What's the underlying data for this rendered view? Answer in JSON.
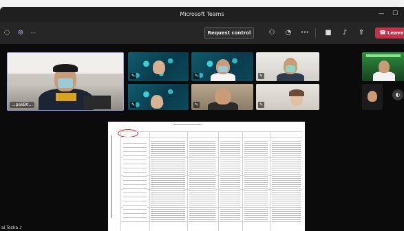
{
  "window": {
    "title": "Microsoft Teams"
  },
  "toolbar": {
    "request_control_label": "Request control",
    "leave_label": "Leave"
  },
  "participants": {
    "speaker_name": "...pakB0...",
    "bottom_name": "al Tosha"
  },
  "colors": {
    "leave_red": "#c4314b",
    "titlebar": "#1f1f1f",
    "toolbar": "#262626"
  }
}
